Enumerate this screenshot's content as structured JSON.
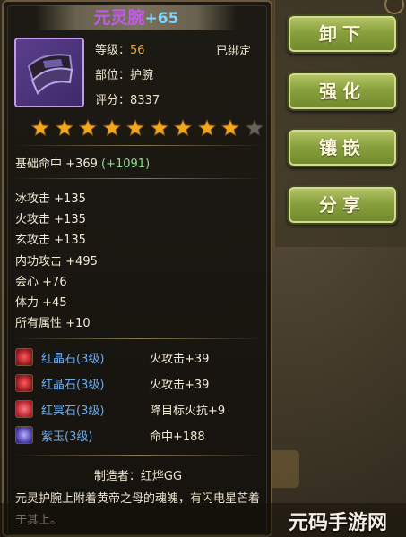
{
  "item": {
    "name": "元灵腕",
    "plus": "+65",
    "level_label": "等级：",
    "level_value": "56",
    "bound": "已绑定",
    "slot_label": "部位：",
    "slot_value": "护腕",
    "score_label": "评分：",
    "score_value": "8337",
    "stars_filled": 9,
    "stars_total": 10
  },
  "base": {
    "label": "基础命中",
    "value": "+369",
    "bonus": "(+1091)"
  },
  "attributes": [
    {
      "name": "冰攻击",
      "value": "+135"
    },
    {
      "name": "火攻击",
      "value": "+135"
    },
    {
      "name": "玄攻击",
      "value": "+135"
    },
    {
      "name": "内功攻击",
      "value": "+495"
    },
    {
      "name": "会心",
      "value": "+76"
    },
    {
      "name": "体力",
      "value": "+45"
    },
    {
      "name": "所有属性",
      "value": "+10"
    }
  ],
  "gems": [
    {
      "name": "红晶石(3级)",
      "stat": "火攻击+39",
      "color": "#c8202a"
    },
    {
      "name": "红晶石(3级)",
      "stat": "火攻击+39",
      "color": "#c8202a"
    },
    {
      "name": "红冥石(3级)",
      "stat": "降目标火抗+9",
      "color": "#d02838"
    },
    {
      "name": "紫玉(3级)",
      "stat": "命中+188",
      "color": "#6a5ad0"
    }
  ],
  "maker": "制造者：红烨GG",
  "description": "元灵护腕上附着黄帝之母的魂魄，有闪电星芒着于其上。",
  "buttons": {
    "unequip": "卸下",
    "enhance": "强化",
    "inlay": "镶嵌",
    "share": "分享"
  },
  "watermark": "元码手游网",
  "colors": {
    "name": "#c15be8",
    "plus": "#7cd6ff",
    "bonus": "#86e08a",
    "gem_name": "#6aa9ec",
    "button": "#8aa03e"
  }
}
